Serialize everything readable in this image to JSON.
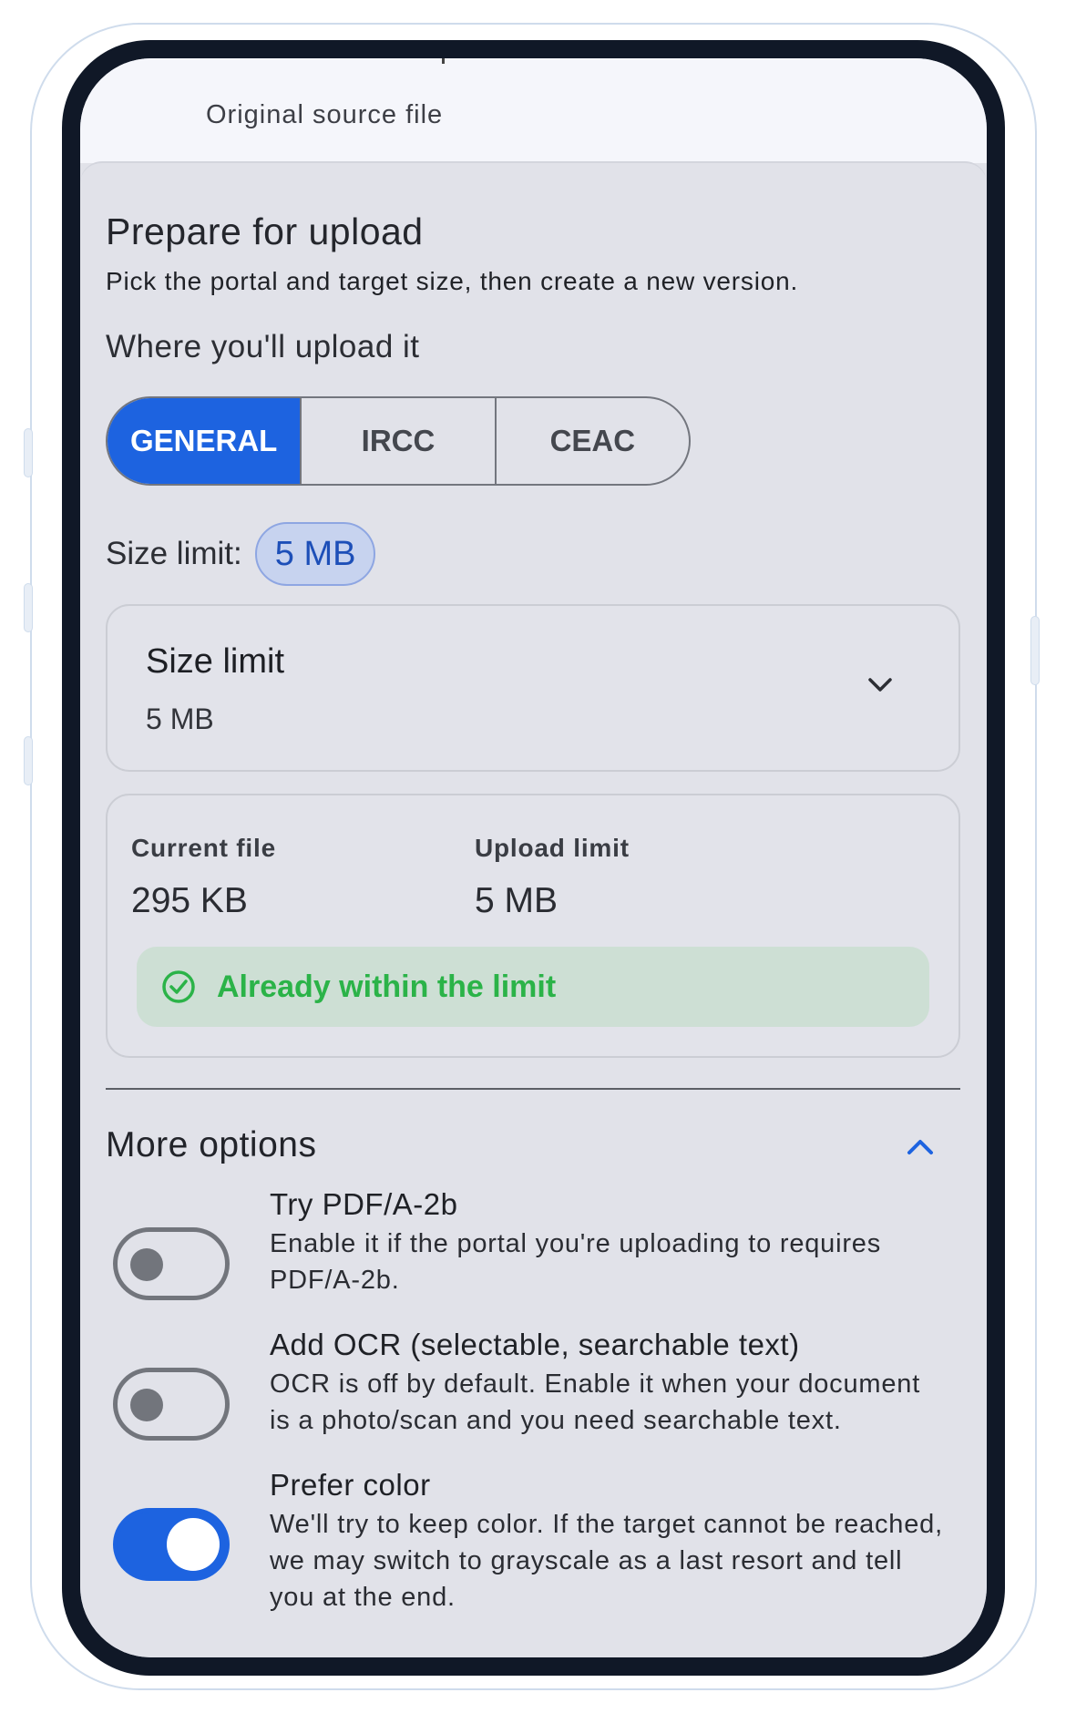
{
  "top": {
    "source_label": "Original source file"
  },
  "header": {
    "title": "Prepare for upload",
    "subtitle": "Pick the portal and target size, then create a new version.",
    "where_label": "Where you'll upload it"
  },
  "portals": [
    {
      "label": "GENERAL",
      "selected": true
    },
    {
      "label": "IRCC",
      "selected": false
    },
    {
      "label": "CEAC",
      "selected": false
    }
  ],
  "size": {
    "row_label": "Size limit:",
    "chip": "5 MB",
    "dropdown_label": "Size limit",
    "dropdown_value": "5 MB"
  },
  "info": {
    "current_label": "Current file",
    "current_value": "295 KB",
    "limit_label": "Upload limit",
    "limit_value": "5 MB",
    "status": "Already within the limit"
  },
  "more": {
    "title": "More options",
    "options": [
      {
        "title": "Try PDF/A-2b",
        "description": "Enable it if the portal you're uploading to requires PDF/A-2b.",
        "enabled": false
      },
      {
        "title": "Add OCR (selectable, searchable text)",
        "description": "OCR is off by default. Enable it when your document is a photo/scan and you need searchable text.",
        "enabled": false
      },
      {
        "title": "Prefer color",
        "description": "We'll try to keep color. If the target cannot be reached, we may switch to grayscale as a last resort and tell you at the end.",
        "enabled": true
      }
    ]
  },
  "colors": {
    "accent": "#1d63e0",
    "success": "#2bb348",
    "success_bg": "#cddfd4",
    "surface": "#e1e2e9"
  },
  "icons": {
    "dropdown": "chevron-down-icon",
    "status": "check-circle-icon",
    "collapse": "chevron-up-icon"
  }
}
